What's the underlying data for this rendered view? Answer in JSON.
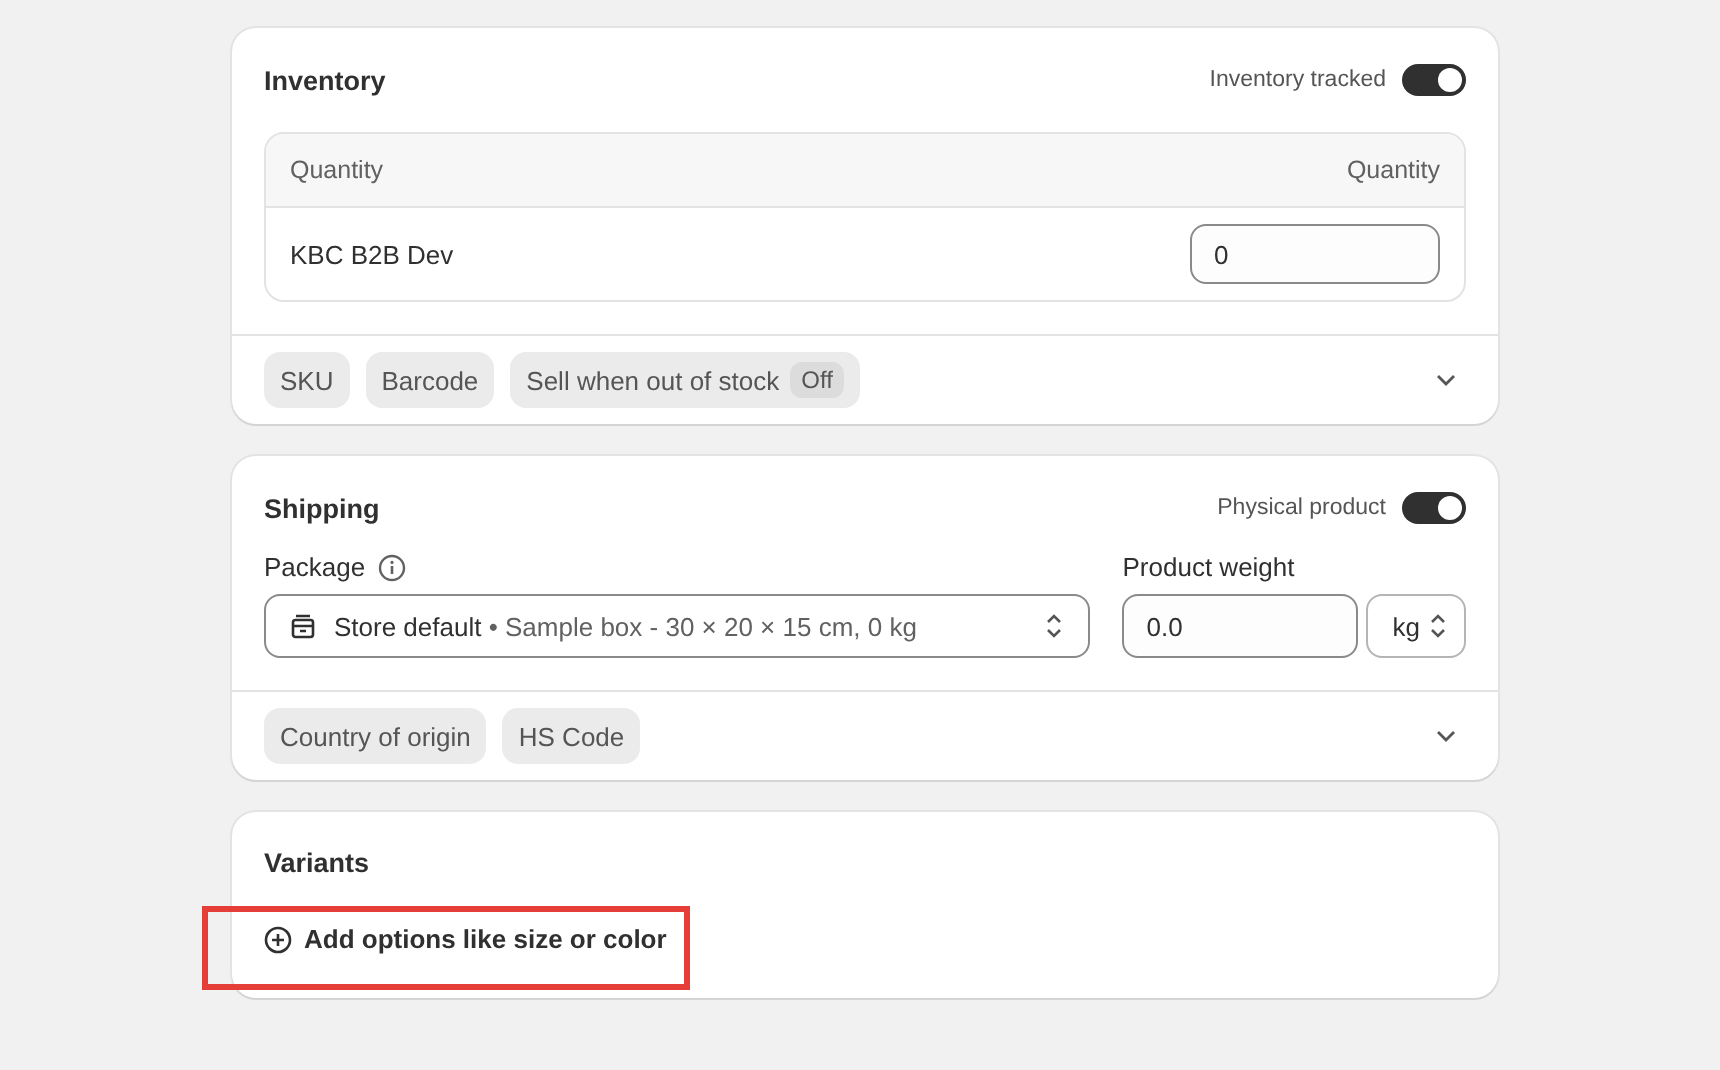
{
  "inventory": {
    "title": "Inventory",
    "toggle": {
      "label": "Inventory tracked",
      "on": true
    },
    "table": {
      "columns": [
        "Quantity",
        "Quantity"
      ],
      "rows": [
        {
          "location": "KBC B2B Dev",
          "quantity": "0"
        }
      ]
    },
    "chips": [
      {
        "label": "SKU"
      },
      {
        "label": "Barcode"
      },
      {
        "label": "Sell when out of stock",
        "badge": "Off"
      }
    ]
  },
  "shipping": {
    "title": "Shipping",
    "toggle": {
      "label": "Physical product",
      "on": true
    },
    "package": {
      "label": "Package",
      "value": "Store default",
      "detail": "• Sample box - 30 × 20 × 15 cm, 0 kg"
    },
    "weight": {
      "label": "Product weight",
      "value": "0.0",
      "unit": "kg"
    },
    "chips": [
      {
        "label": "Country of origin"
      },
      {
        "label": "HS Code"
      }
    ]
  },
  "variants": {
    "title": "Variants",
    "add_button": {
      "label": "Add options like size or color",
      "highlighted": true
    }
  }
}
